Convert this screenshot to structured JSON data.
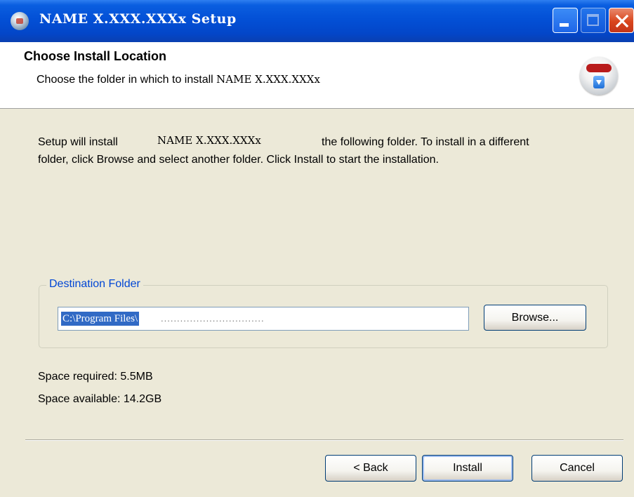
{
  "window": {
    "title": "NAME X.XXX.XXXx Setup"
  },
  "header": {
    "title": "Choose Install Location",
    "subtitle_prefix": "Choose the folder in which to install ",
    "product": "NAME X.XXX.XXXx"
  },
  "body": {
    "line1_start": "Setup will install",
    "product": "NAME X.XXX.XXXx",
    "line1_end": "the following folder. To install in a different",
    "line2": "folder, click Browse and select another folder. Click Install to start the installation."
  },
  "destination": {
    "group_label": "Destination Folder",
    "path_selected": "C:\\Program Files\\",
    "path_rest": "................................",
    "browse_label": "Browse..."
  },
  "space": {
    "required": "Space required: 5.5MB",
    "available": "Space available: 14.2GB"
  },
  "buttons": {
    "back": "< Back",
    "install": "Install",
    "cancel": "Cancel"
  },
  "colors": {
    "titlebar": "#0350d6",
    "dialog_bg": "#ece9d8",
    "group_label": "#0046d5",
    "selection": "#316ac5"
  }
}
